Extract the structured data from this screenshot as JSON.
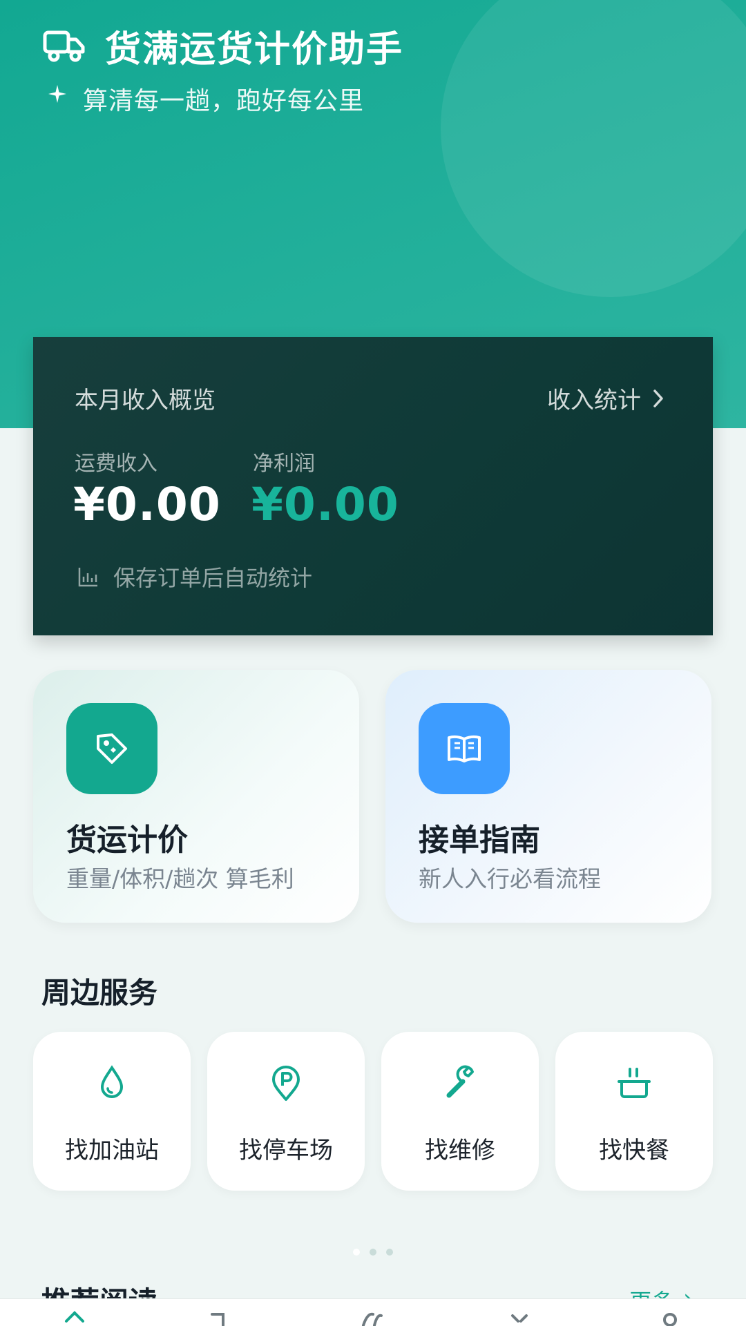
{
  "header": {
    "title": "货满运货计价助手",
    "subtitle": "算清每一趟，跑好每公里"
  },
  "income": {
    "title": "本月收入概览",
    "link_label": "收入统计",
    "freight_label": "运费收入",
    "freight_value": "¥0.00",
    "profit_label": "净利润",
    "profit_value": "¥0.00",
    "auto_note": "保存订单后自动统计"
  },
  "features": [
    {
      "title": "货运计价",
      "desc": "重量/体积/趟次 算毛利",
      "icon": "price-tag-icon",
      "icon_color": "#13a88f"
    },
    {
      "title": "接单指南",
      "desc": "新人入行必看流程",
      "icon": "book-icon",
      "icon_color": "#3d9cff"
    }
  ],
  "nearby": {
    "title": "周边服务",
    "items": [
      {
        "label": "找加油站",
        "icon": "fuel-drop-icon"
      },
      {
        "label": "找停车场",
        "icon": "parking-pin-icon"
      },
      {
        "label": "找维修",
        "icon": "wrench-icon"
      },
      {
        "label": "找快餐",
        "icon": "food-bowl-icon"
      }
    ]
  },
  "recommend": {
    "title": "推荐阅读",
    "more": "更多"
  },
  "colors": {
    "brand": "#13a88f",
    "card_dark": "#0f3a37",
    "blue": "#3d9cff"
  }
}
